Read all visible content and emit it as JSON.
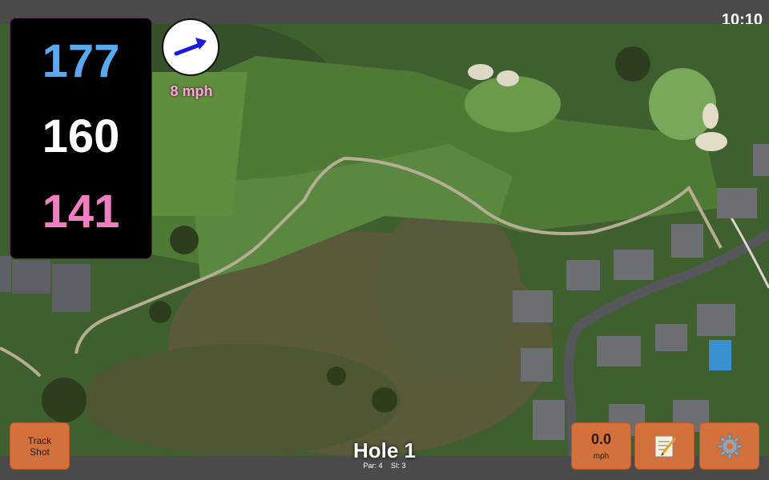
{
  "status": {
    "time": "10:10"
  },
  "distances": {
    "back": "177",
    "middle": "160",
    "front": "141"
  },
  "wind": {
    "speed_label": "8 mph",
    "arrow_icon": "wind-direction-arrow-icon"
  },
  "buttons": {
    "track_shot_line1": "Track",
    "track_shot_line2": "Shot",
    "speed_value": "0.0",
    "speed_unit": "mph",
    "notes_icon": "notepad-icon",
    "settings_icon": "gear-icon"
  },
  "hole": {
    "title": "Hole 1",
    "par": "Par: 4",
    "si": "SI: 3"
  },
  "colors": {
    "back_distance": "#5aa9f0",
    "middle_distance": "#ffffff",
    "front_distance": "#f07fc1",
    "button_accent": "#d4703c",
    "wind_label": "#f3a5e3"
  }
}
